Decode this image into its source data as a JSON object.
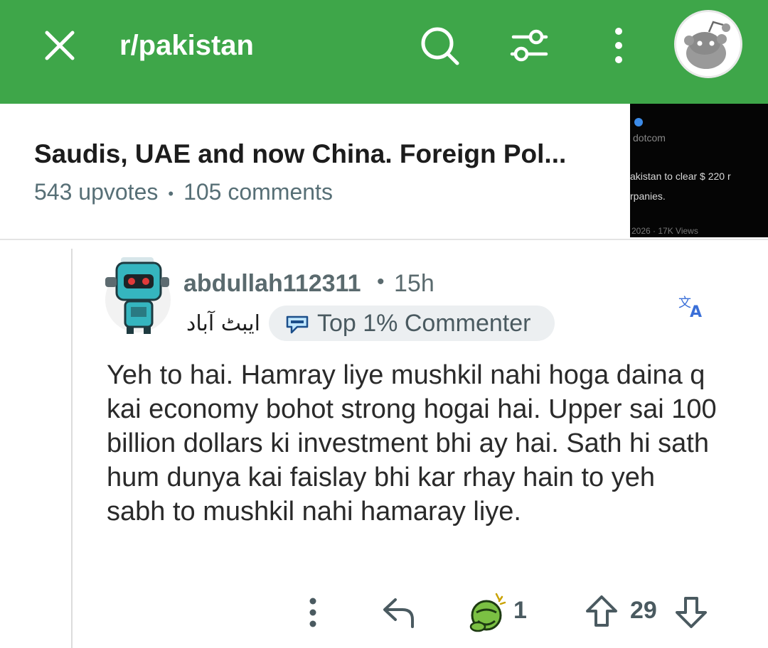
{
  "header": {
    "subreddit": "r/pakistan",
    "icons": [
      "close-icon",
      "search-icon",
      "filter-icon",
      "more-vertical-icon",
      "snoo-avatar"
    ],
    "bar_color": "#3ea649"
  },
  "post": {
    "title": "Saudis, UAE and now China. Foreign Pol...",
    "upvotes": "543 upvotes",
    "separator": "•",
    "comments": "105 comments",
    "thumbnail_lines": [
      "dotcom",
      "akistan to clear $ 220 r",
      "rpanies.",
      "2026 · 17K Views"
    ]
  },
  "comment": {
    "username": "abdullah112311",
    "separator": "•",
    "age": "15h",
    "flair": "ایبٹ آباد",
    "badge": "Top 1% Commenter",
    "body": "Yeh to hai. Hamray liye mushkil nahi hoga daina q kai economy bohot strong hogai hai. Upper sai 100 billion dollars ki investment bhi ay hai. Sath hi sath hum dunya kai faislay bhi kar rhay hain to yeh sabh to mushkil nahi hamaray liye.",
    "award_count": "1",
    "score": "29",
    "action_icons": [
      "more-vertical-icon",
      "reply-icon",
      "award-icon",
      "upvote-icon",
      "downvote-icon"
    ]
  }
}
